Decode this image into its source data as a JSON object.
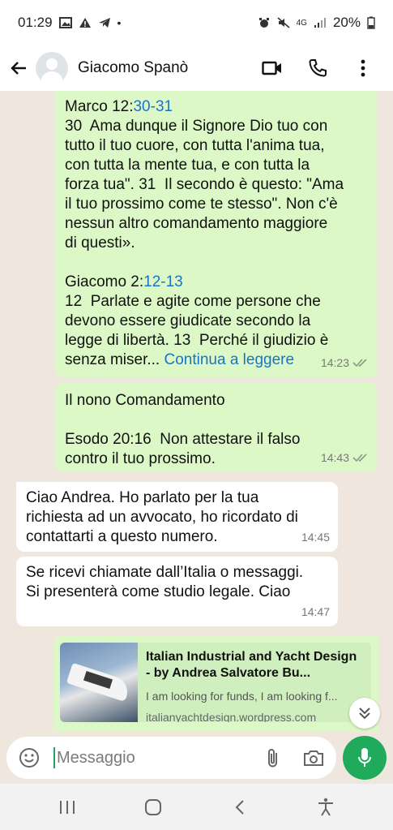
{
  "status_bar": {
    "time": "01:29",
    "network": "4G",
    "battery": "20%"
  },
  "header": {
    "contact_name": "Giacomo Spanò",
    "icons": [
      "back-arrow-icon",
      "video-call-icon",
      "phone-icon",
      "more-vert-icon"
    ]
  },
  "messages": [
    {
      "direction": "out",
      "ref1_book": "Marco 12:",
      "ref1_link": "30-31",
      "body1": "30  Ama dunque il Signore Dio tuo con\ntutto il tuo cuore, con tutta l'anima tua,\ncon tutta la mente tua, e con tutta la\nforza tua\". 31  Il secondo è questo: \"Ama\nil tuo prossimo come te stesso\". Non c'è\nnessun altro comandamento maggiore\ndi questi».",
      "ref2_book": "Giacomo 2:",
      "ref2_link": "12-13",
      "body2": "12  Parlate e agite come persone che\ndevono essere giudicate secondo la\nlegge di libertà. 13  Perché il giudizio è\nsenza miser...",
      "read_more": "Continua a leggere",
      "time": "14:23"
    },
    {
      "direction": "out",
      "text": "Il nono Comandamento\n\nEsodo 20:16  Non attestare il falso\ncontro il tuo prossimo.",
      "time": "14:43"
    },
    {
      "direction": "in",
      "text": "Ciao Andrea. Ho parlato per la tua\nrichiesta ad un avvocato, ho ricordato di\ncontattarti a questo numero.",
      "time": "14:45"
    },
    {
      "direction": "in",
      "text": "Se ricevi chiamate dall’Italia o messaggi.\nSi presenterà come studio legale. Ciao",
      "time": "14:47"
    },
    {
      "direction": "out",
      "preview_title": "Italian Industrial and Yacht Design - by Andrea Salvatore Bu...",
      "preview_desc": "I am looking for funds, I am looking f...",
      "preview_domain": "italianyachtdesign.wordpress.com"
    }
  ],
  "input": {
    "placeholder": "Messaggio"
  },
  "colors": {
    "outgoing_bubble": "#dcf8c6",
    "incoming_bubble": "#ffffff",
    "chat_background": "#efe7de",
    "accent_green": "#1faa5c",
    "link_blue": "#1a73c8"
  }
}
